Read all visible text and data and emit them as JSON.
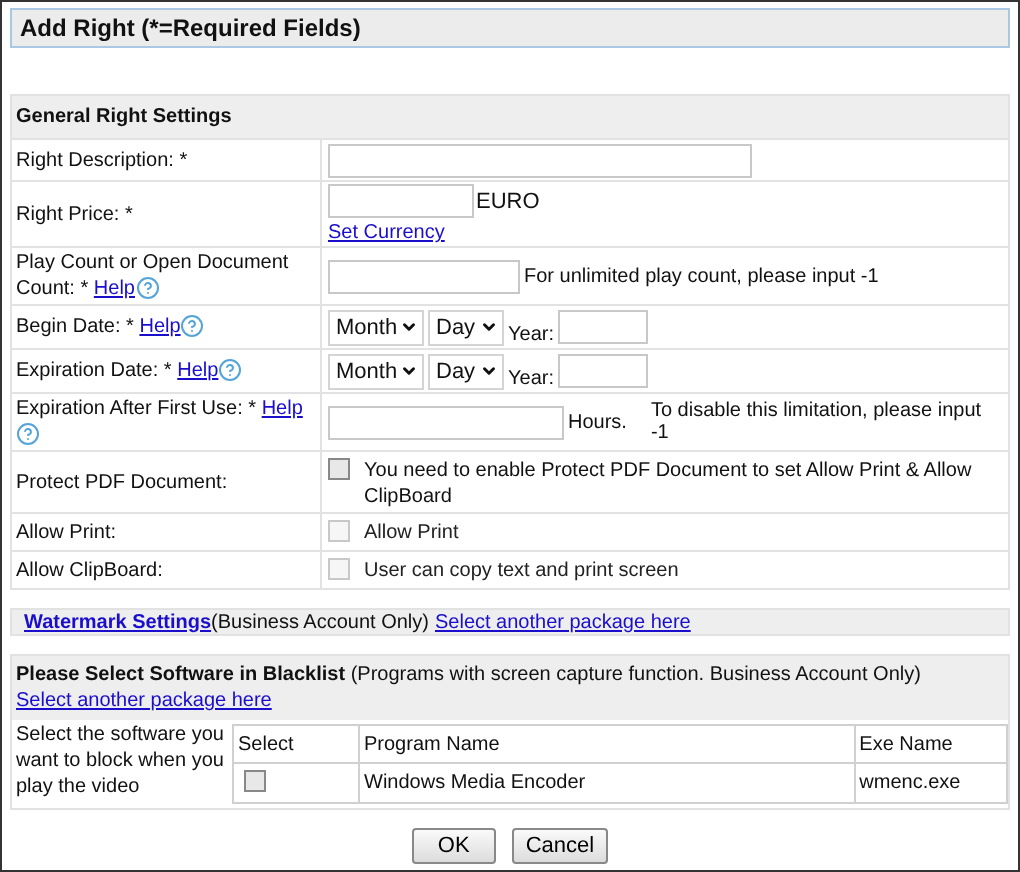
{
  "title": "Add Right (*=Required Fields)",
  "general": {
    "heading": "General Right Settings",
    "rows": [
      {
        "kind": "text",
        "label": "Right Description: *"
      },
      {
        "kind": "price",
        "label": "Right Price: *",
        "unit": "EURO",
        "link": "Set Currency"
      },
      {
        "kind": "count",
        "label": "Play Count or Open Document Count: *",
        "help": "Help",
        "note": "For unlimited play count, please input -1"
      },
      {
        "kind": "date",
        "label": "Begin Date: *",
        "help": "Help",
        "month": "Month",
        "day": "Day",
        "year_label": "Year:"
      },
      {
        "kind": "date",
        "label": "Expiration Date: *",
        "help": "Help",
        "month": "Month",
        "day": "Day",
        "year_label": "Year:"
      },
      {
        "kind": "hours",
        "label": "Expiration After First Use: *",
        "help": "Help",
        "unit": "Hours.",
        "note": "To disable this limitation, please input -1"
      },
      {
        "kind": "checkbox",
        "label": "Protect PDF Document:",
        "text": "You need to enable Protect PDF Document to set Allow Print & Allow ClipBoard",
        "checked": false,
        "disabled": false
      },
      {
        "kind": "checkbox",
        "label": "Allow Print:",
        "text": "Allow Print",
        "checked": false,
        "disabled": true
      },
      {
        "kind": "checkbox",
        "label": "Allow ClipBoard:",
        "text": "User can copy text and print screen",
        "checked": false,
        "disabled": true
      }
    ]
  },
  "watermark": {
    "link": "Watermark Settings",
    "note": "(Business Account Only)",
    "package_link": "Select another package here"
  },
  "blacklist": {
    "heading": "Please Select Software in Blacklist",
    "note": "(Programs with screen capture function. Business Account Only)",
    "package_link": "Select another package here",
    "description": "Select the software you want to block when you play the video",
    "columns": [
      "Select",
      "Program Name",
      "Exe Name"
    ],
    "rows": [
      {
        "checked": false,
        "program": "Windows Media Encoder",
        "exe": "wmenc.exe"
      }
    ]
  },
  "buttons": [
    "OK",
    "Cancel"
  ]
}
